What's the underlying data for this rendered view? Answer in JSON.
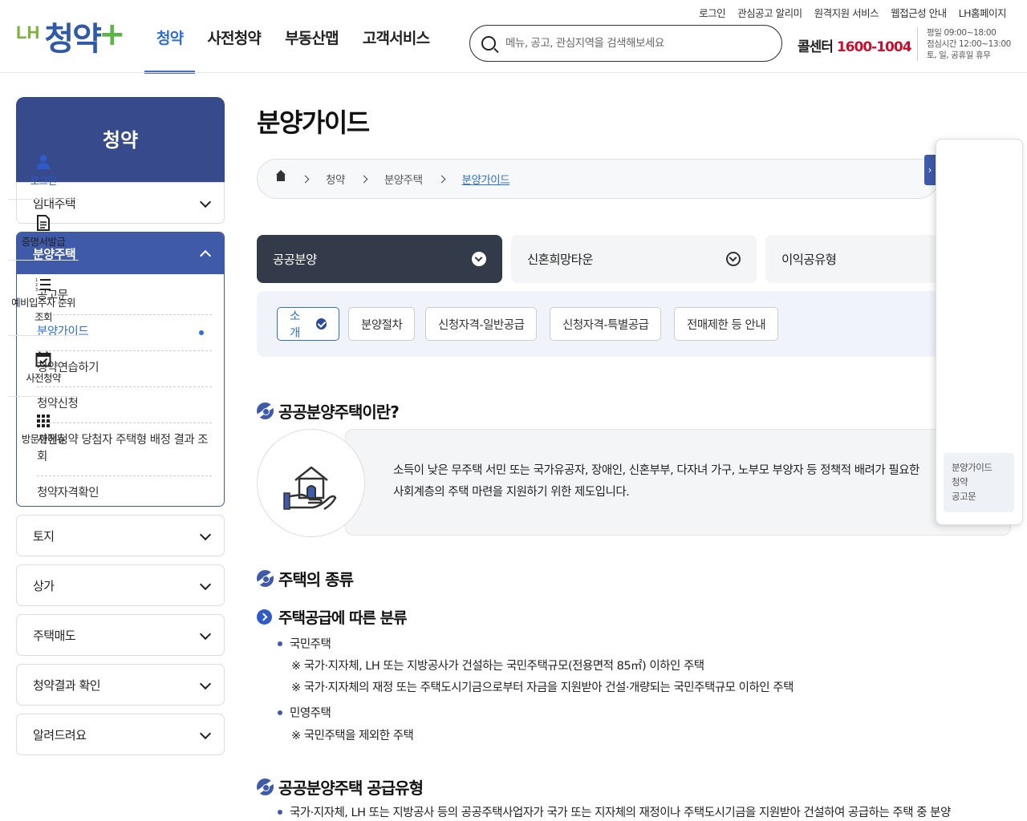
{
  "header": {
    "util_links": [
      "로그인",
      "관심공고 알리미",
      "원격지원 서비스",
      "웹접근성 안내",
      "LH홈페이지"
    ],
    "logo_prefix": "LH",
    "logo_main": "청약",
    "logo_plus": "+",
    "nav": [
      "청약",
      "사전청약",
      "부동산맵",
      "고객서비스"
    ],
    "nav_active": "청약",
    "search_placeholder": "메뉴, 공고, 관심지역을 검색해보세요",
    "callcenter_label": "콜센터",
    "callcenter_number": "1600-1004",
    "hours": [
      "평일 09:00~18:00",
      "점심시간 12:00~13:00",
      "토, 일, 공휴일 휴무"
    ]
  },
  "sidebar": {
    "title": "청약",
    "items": [
      "임대주택",
      "분양주택",
      "토지",
      "상가",
      "주택매도",
      "청약결과 확인",
      "알려드려요"
    ],
    "open_item": "분양주택",
    "sub_items": [
      "공고문",
      "분양가이드",
      "청약연습하기",
      "청약신청",
      "사전청약 당첨자 주택형 배정 결과 조회",
      "청약자격확인"
    ],
    "sub_active": "분양가이드"
  },
  "main": {
    "title": "분양가이드",
    "breadcrumb": [
      "청약",
      "분양주택",
      "분양가이드"
    ],
    "tabs": [
      "공공분양",
      "신혼희망타운",
      "이익공유형"
    ],
    "tab_active": "공공분양",
    "subtabs": [
      "소개",
      "분양절차",
      "신청자격-일반공급",
      "신청자격-특별공급",
      "전매제한 등 안내"
    ],
    "subtab_active": "소개",
    "section1_title": "공공분양주택이란?",
    "intro_lines": [
      "소득이 낮은 무주택 서민 또는 국가유공자, 장애인, 신혼부부, 다자녀 가구, 노부모 부양자 등 정책적 배려가 필요한",
      "사회계층의 주택 마련을 지원하기 위한 제도입니다."
    ],
    "section2_title": "주택의 종류",
    "section2_sub": "주택공급에 따른 분류",
    "type1": "국민주택",
    "type1_notes": [
      "※  국가·지자체, LH 또는 지방공사가 건설하는 국민주택규모(전용면적 85㎡) 이하인 주택",
      "※  국가·지자체의 재정 또는 주택도시기금으로부터 자금을 지원받아 건설·개량되는 국민주택규모 이하인 주택"
    ],
    "type2": "민영주택",
    "type2_notes": [
      "※  국민주택을 제외한 주택"
    ],
    "section3_title": "공공분양주택 공급유형",
    "section3_line": "국가·지자체, LH 또는 지방공사 등의 공공주택사업자가 국가 또는 지자체의 재정이나 주택도시기금을 지원받아 건설하여 공급하는 주택 중 분양"
  },
  "quick_menu": {
    "items": [
      "로그인",
      "증명서발급",
      "예비입주자 순위 조회",
      "사전청약",
      "방문한메뉴"
    ],
    "recent": [
      "분양가이드",
      "청약",
      "공고문"
    ],
    "toggle_glyph": "›"
  },
  "colors": {
    "primary": "#3e5aa8",
    "accent_blue": "#2f6fd1",
    "dark_tab": "#333b4a",
    "call_red": "#c8102e",
    "logo_green": "#5db546"
  }
}
